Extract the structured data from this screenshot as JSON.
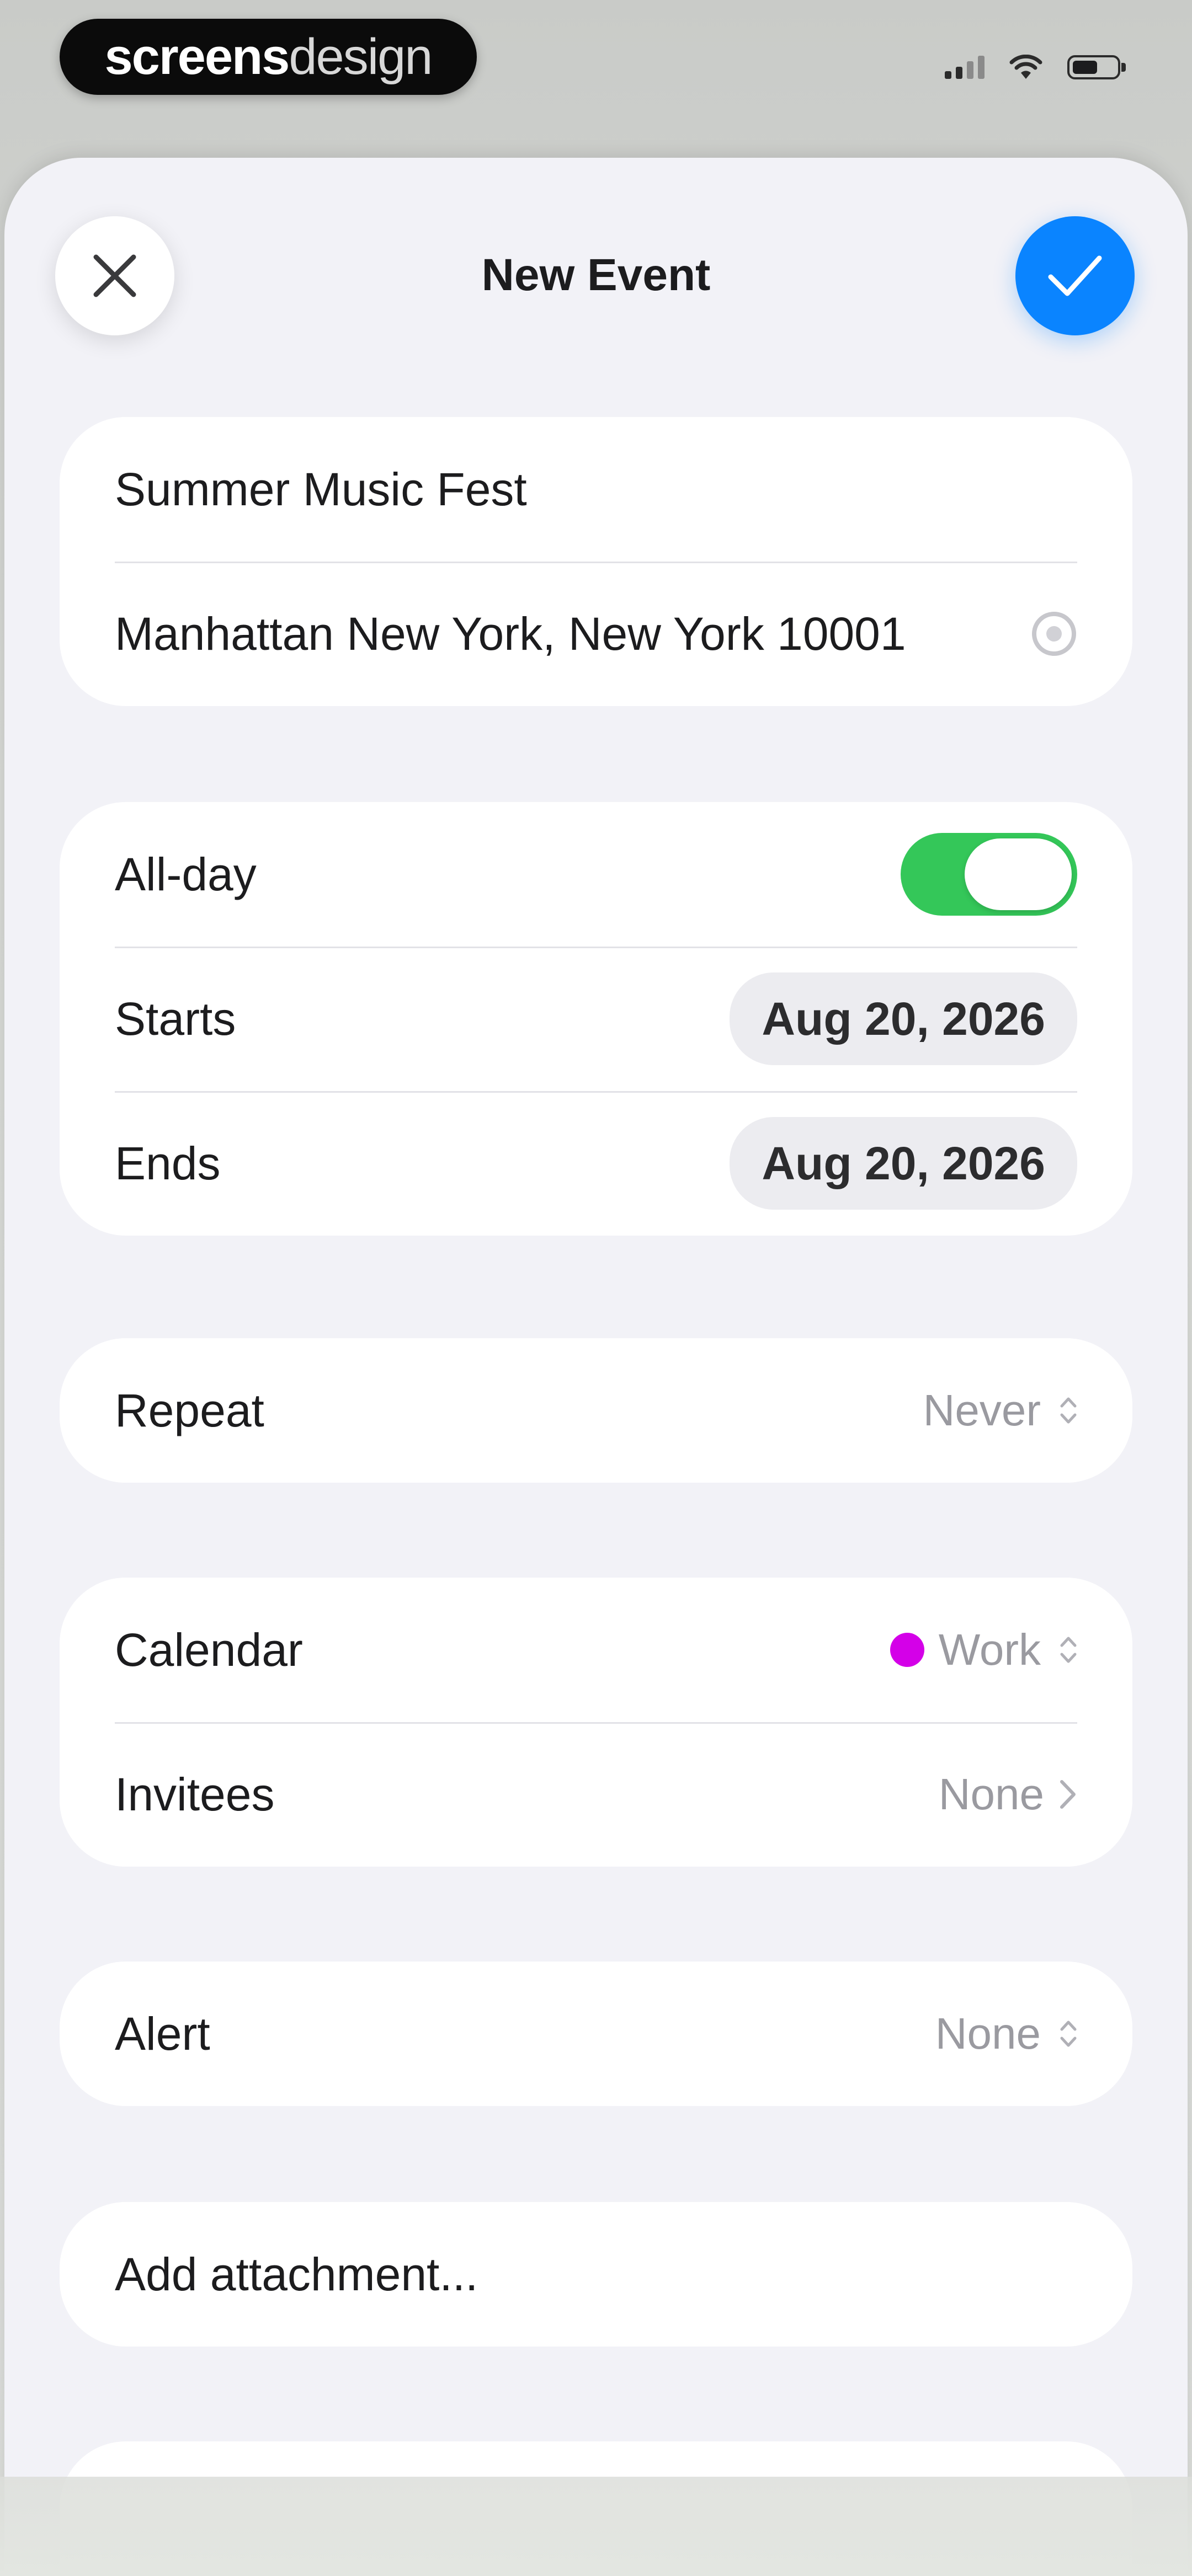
{
  "status_bar": {
    "brand_bold": "screens",
    "brand_light": "design"
  },
  "header": {
    "title": "New Event"
  },
  "details": {
    "title_value": "Summer Music Fest",
    "location_value": "Manhattan New York, New York 10001"
  },
  "schedule": {
    "all_day_label": "All-day",
    "all_day_on": true,
    "starts_label": "Starts",
    "starts_value": "Aug 20, 2026",
    "ends_label": "Ends",
    "ends_value": "Aug 20, 2026"
  },
  "repeat": {
    "label": "Repeat",
    "value": "Never"
  },
  "calendar": {
    "label": "Calendar",
    "value": "Work",
    "color": "#d400e8",
    "invitees_label": "Invitees",
    "invitees_value": "None"
  },
  "alert": {
    "label": "Alert",
    "value": "None"
  },
  "attachment": {
    "label": "Add attachment..."
  },
  "colors": {
    "accent": "#0a84ff",
    "toggle_on": "#34c759"
  }
}
